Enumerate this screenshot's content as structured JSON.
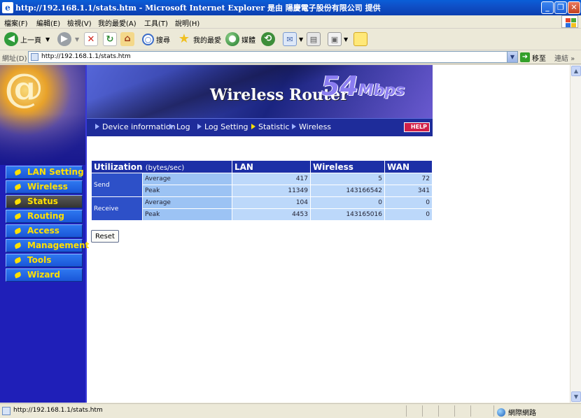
{
  "window": {
    "title": "http://192.168.1.1/stats.htm - Microsoft Internet Explorer 是由 陽慶電子股份有限公司 提供",
    "minimize": "_",
    "maximize": "❐",
    "close": "✕"
  },
  "menu": {
    "items": [
      "檔案(F)",
      "編輯(E)",
      "檢視(V)",
      "我的最愛(A)",
      "工具(T)",
      "說明(H)"
    ]
  },
  "toolbar": {
    "back_label": "上一頁",
    "search_label": "搜尋",
    "favorites_label": "我的最愛",
    "media_label": "媒體"
  },
  "address": {
    "label": "網址(D)",
    "url": "http://192.168.1.1/stats.htm",
    "go_label": "移至",
    "links_label": "連結 »"
  },
  "router": {
    "banner_title": "Wireless Router",
    "banner_speed": "54",
    "banner_unit": "Mbps",
    "help_label": "HELP",
    "logo_glyph": "@",
    "top_nav": [
      {
        "label": "Device information",
        "current": false
      },
      {
        "label": "Log",
        "current": false
      },
      {
        "label": "Log Setting",
        "current": false
      },
      {
        "label": "Statistic",
        "current": true
      },
      {
        "label": "Wireless",
        "current": false
      }
    ],
    "side_nav": [
      {
        "label": "LAN Setting",
        "active": false
      },
      {
        "label": "Wireless",
        "active": false
      },
      {
        "label": "Status",
        "active": true
      },
      {
        "label": "Routing",
        "active": false
      },
      {
        "label": "Access",
        "active": false
      },
      {
        "label": "Management",
        "active": false
      },
      {
        "label": "Tools",
        "active": false
      },
      {
        "label": "Wizard",
        "active": false
      }
    ]
  },
  "stats": {
    "header": {
      "utilization": "Utilization",
      "unit": "(bytes/sec)",
      "lan": "LAN",
      "wireless": "Wireless",
      "wan": "WAN"
    },
    "groups": [
      {
        "name": "Send",
        "rows": [
          {
            "label": "Average",
            "lan": "417",
            "wireless": "5",
            "wan": "72"
          },
          {
            "label": "Peak",
            "lan": "11349",
            "wireless": "143166542",
            "wan": "341"
          }
        ]
      },
      {
        "name": "Receive",
        "rows": [
          {
            "label": "Average",
            "lan": "104",
            "wireless": "0",
            "wan": "0"
          },
          {
            "label": "Peak",
            "lan": "4453",
            "wireless": "143165016",
            "wan": "0"
          }
        ]
      }
    ],
    "reset_label": "Reset"
  },
  "status": {
    "text": "http://192.168.1.1/stats.htm",
    "zone": "網際網路"
  }
}
